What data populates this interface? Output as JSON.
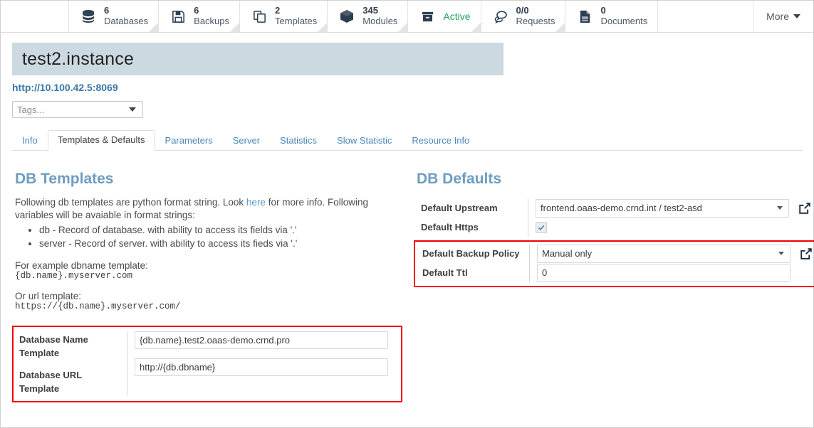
{
  "statbar": {
    "tiles": [
      {
        "icon": "database-stack-icon",
        "count": "6",
        "label": "Databases"
      },
      {
        "icon": "floppy-disk-icon",
        "count": "6",
        "label": "Backups"
      },
      {
        "icon": "copy-pages-icon",
        "count": "2",
        "label": "Templates"
      },
      {
        "icon": "cube-icon",
        "count": "345",
        "label": "Modules"
      },
      {
        "icon": "archive-box-icon",
        "count": "",
        "label": "Active"
      },
      {
        "icon": "speech-bubbles-icon",
        "count": "0/0",
        "label": "Requests"
      },
      {
        "icon": "document-icon",
        "count": "0",
        "label": "Documents"
      }
    ],
    "more_label": "More",
    "active_color": "#28a05a"
  },
  "header": {
    "title": "test2.instance",
    "url": "http://10.100.42.5:8069",
    "tags_placeholder": "Tags...",
    "title_bg": "#ccd9e0"
  },
  "tabs": [
    {
      "label": "Info",
      "active": false
    },
    {
      "label": "Templates & Defaults",
      "active": true
    },
    {
      "label": "Parameters",
      "active": false
    },
    {
      "label": "Server",
      "active": false
    },
    {
      "label": "Statistics",
      "active": false
    },
    {
      "label": "Slow Statistic",
      "active": false
    },
    {
      "label": "Resource Info",
      "active": false
    }
  ],
  "db_templates": {
    "section_title": "DB Templates",
    "intro_part1": "Following db templates are python format string. Look ",
    "intro_link": "here",
    "intro_part2": " for more info. Following variables will be avaiable in format strings:",
    "variables": [
      "db - Record of database. with ability to access its fields via '.'",
      "server - Record of server. with ability to access its fieds via '.'"
    ],
    "example_lead": "For example dbname template:",
    "example_code": "{db.name}.myserver.com",
    "url_lead": "Or url template:",
    "url_code": "https://{db.name}.myserver.com/",
    "form": {
      "highlighted": true,
      "fields": [
        {
          "label": "Database Name Template",
          "value": "{db.name}.test2.oaas-demo.crnd.pro"
        },
        {
          "label": "Database URL Template",
          "value": "http://{db.dbname}"
        }
      ]
    }
  },
  "db_defaults": {
    "section_title": "DB Defaults",
    "rows": [
      {
        "label": "Default Upstream",
        "type": "select",
        "value": "frontend.oaas-demo.crnd.int / test2-asd",
        "has_external_link": true,
        "highlighted": false
      },
      {
        "label": "Default Https",
        "type": "checkbox",
        "value": "checked",
        "has_external_link": false,
        "highlighted": false
      },
      {
        "label": "Default Backup Policy",
        "type": "select",
        "value": "Manual only",
        "has_external_link": true,
        "highlighted": true
      },
      {
        "label": "Default Ttl",
        "type": "text",
        "value": "0",
        "has_external_link": false,
        "highlighted": true
      }
    ]
  },
  "colors": {
    "highlight_box": "#ef0000",
    "section_heading": "#6f9dc0",
    "link": "#3b77a8"
  }
}
